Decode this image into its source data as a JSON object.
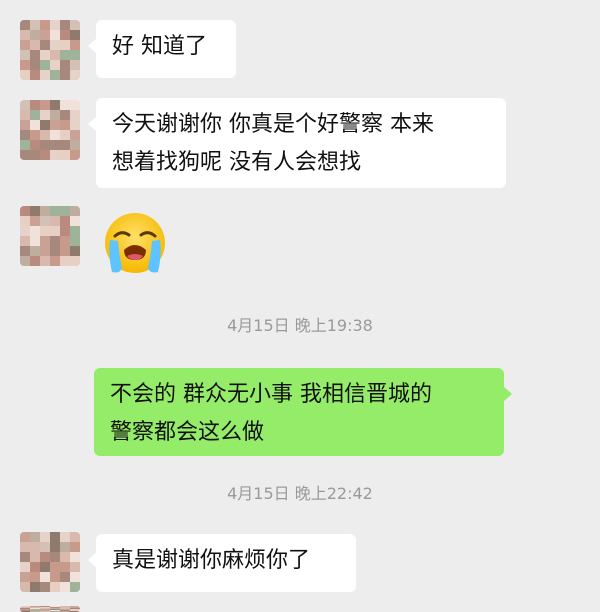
{
  "messages": [
    {
      "side": "left",
      "lines": [
        "好 知道了"
      ]
    },
    {
      "side": "left",
      "lines": [
        "今天谢谢你 你真是个好警察 本来",
        "想着找狗呢 没有人会想找"
      ]
    },
    {
      "side": "left",
      "emoji": "crying-face-icon"
    },
    {
      "timestamp": "4月15日 晚上19:38"
    },
    {
      "side": "right",
      "lines": [
        "不会的 群众无小事 我相信晋城的",
        "警察都会这么做"
      ]
    },
    {
      "timestamp": "4月15日 晚上22:42"
    },
    {
      "side": "left",
      "lines": [
        "真是谢谢你麻烦你了"
      ]
    }
  ],
  "colors": {
    "background": "#ededed",
    "incoming_bubble": "#ffffff",
    "outgoing_bubble": "#95ec69",
    "timestamp_text": "#9a9a9a"
  }
}
